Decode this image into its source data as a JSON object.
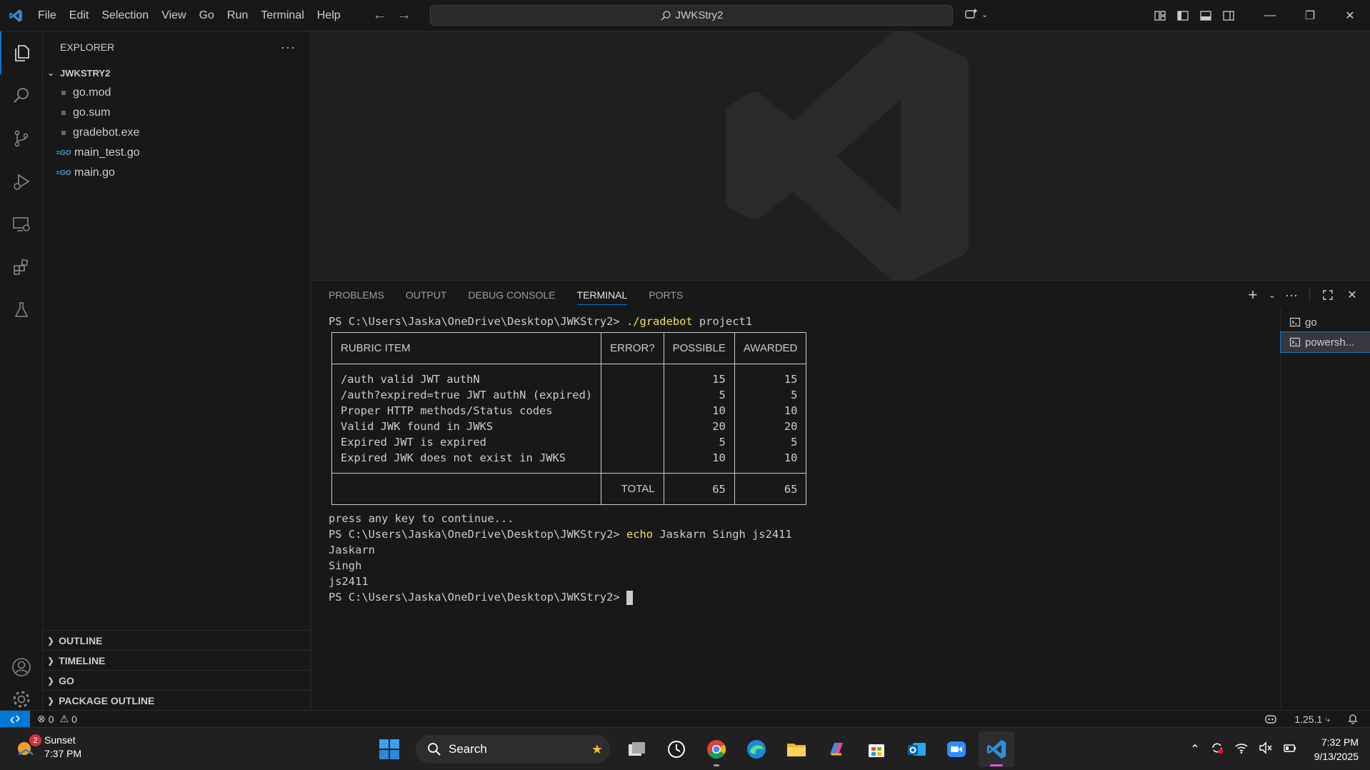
{
  "menu": [
    "File",
    "Edit",
    "Selection",
    "View",
    "Go",
    "Run",
    "Terminal",
    "Help"
  ],
  "command_center": {
    "label": "JWKStry2"
  },
  "explorer": {
    "title": "EXPLORER",
    "folder": "JWKSTRY2",
    "files": [
      {
        "name": "go.mod",
        "icon": "lines-file-icon"
      },
      {
        "name": "go.sum",
        "icon": "lines-file-icon"
      },
      {
        "name": "gradebot.exe",
        "icon": "lines-file-icon"
      },
      {
        "name": "main_test.go",
        "icon": "go-file-icon"
      },
      {
        "name": "main.go",
        "icon": "go-file-icon"
      }
    ],
    "sections": [
      "OUTLINE",
      "TIMELINE",
      "GO",
      "PACKAGE OUTLINE"
    ]
  },
  "panel": {
    "tabs": [
      "PROBLEMS",
      "OUTPUT",
      "DEBUG CONSOLE",
      "TERMINAL",
      "PORTS"
    ],
    "active_tab": "TERMINAL",
    "terminals": [
      "go",
      "powersh..."
    ]
  },
  "terminal": {
    "prompt": "PS C:\\Users\\Jaska\\OneDrive\\Desktop\\JWKStry2> ",
    "cmd1": "./gradebot",
    "cmd1_args": " project1",
    "table": {
      "headers": [
        "RUBRIC ITEM",
        "ERROR?",
        "POSSIBLE",
        "AWARDED"
      ],
      "rows": [
        {
          "item": "/auth valid JWT authN",
          "error": "",
          "possible": "15",
          "awarded": "15"
        },
        {
          "item": "/auth?expired=true JWT authN (expired)",
          "error": "",
          "possible": "5",
          "awarded": "5"
        },
        {
          "item": "Proper HTTP methods/Status codes",
          "error": "",
          "possible": "10",
          "awarded": "10"
        },
        {
          "item": "Valid JWK found in JWKS",
          "error": "",
          "possible": "20",
          "awarded": "20"
        },
        {
          "item": "Expired JWT is expired",
          "error": "",
          "possible": "5",
          "awarded": "5"
        },
        {
          "item": "Expired JWK does not exist in JWKS",
          "error": "",
          "possible": "10",
          "awarded": "10"
        }
      ],
      "total_label": "TOTAL",
      "total_possible": "65",
      "total_awarded": "65"
    },
    "continue_msg": "press any key to continue...",
    "cmd2": "echo",
    "cmd2_args": " Jaskarn Singh js2411",
    "output": [
      "Jaskarn",
      "Singh",
      "js2411"
    ]
  },
  "status": {
    "errors": "0",
    "warnings": "0",
    "go_version": "1.25.1"
  },
  "taskbar": {
    "weather_label": "Sunset",
    "weather_time": "7:37 PM",
    "weather_badge": "2",
    "search_label": "Search",
    "time": "7:32 PM",
    "date": "9/13/2025"
  },
  "colors": {
    "accent": "#0078d4",
    "command": "#f1e05a",
    "go_icon": "#519aba"
  }
}
